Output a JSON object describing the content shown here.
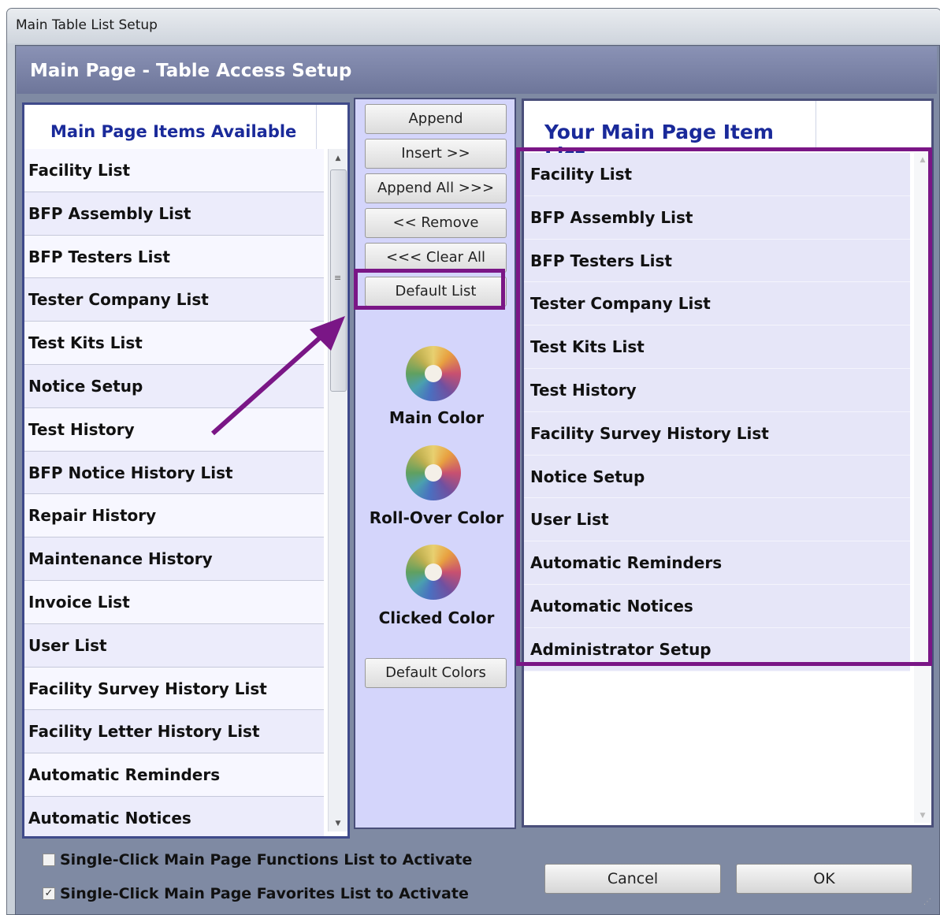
{
  "window": {
    "title": "Main Table List Setup",
    "header": "Main Page - Table Access Setup"
  },
  "available_list": {
    "header": "Main Page Items Available",
    "items": [
      "Facility List",
      "BFP Assembly List",
      "BFP Testers List",
      "Tester Company List",
      "Test Kits List",
      "Notice Setup",
      "Test History",
      "BFP Notice History List",
      "Repair History",
      "Maintenance History",
      "Invoice List",
      "User List",
      "Facility Survey History List",
      "Facility Letter History List",
      "Automatic Reminders",
      "Automatic Notices"
    ]
  },
  "actions": {
    "append": "Append",
    "insert": "Insert >>",
    "append_all": "Append All >>>",
    "remove": "<< Remove",
    "clear_all": "<<< Clear All",
    "default_list": "Default List",
    "main_color": "Main Color",
    "rollover_color": "Roll-Over Color",
    "clicked_color": "Clicked Color",
    "default_colors": "Default Colors"
  },
  "my_list": {
    "header": "Your Main Page Item List",
    "items": [
      "Facility List",
      "BFP Assembly List",
      "BFP Testers List",
      "Tester Company List",
      "Test Kits List",
      "Test History",
      "Facility Survey History List",
      "Notice Setup",
      "User List",
      "Automatic Reminders",
      "Automatic Notices",
      "Administrator Setup"
    ]
  },
  "options": {
    "functions_checkbox": {
      "label": "Single-Click Main Page Functions List to Activate",
      "checked": false
    },
    "favorites_checkbox": {
      "label": "Single-Click Main Page Favorites List to Activate",
      "checked": true
    }
  },
  "buttons": {
    "cancel": "Cancel",
    "ok": "OK"
  },
  "colors": {
    "annotation_highlight": "#7a1686",
    "header_text": "#1a2a9a",
    "middle_panel": "#d4d5fb"
  },
  "icons": {
    "color_picker": "color-wheel-icon",
    "check_mark": "✓",
    "scroll_up": "▲",
    "scroll_down": "▼",
    "scroll_grip": "≡",
    "resize_grip": "⋰"
  }
}
